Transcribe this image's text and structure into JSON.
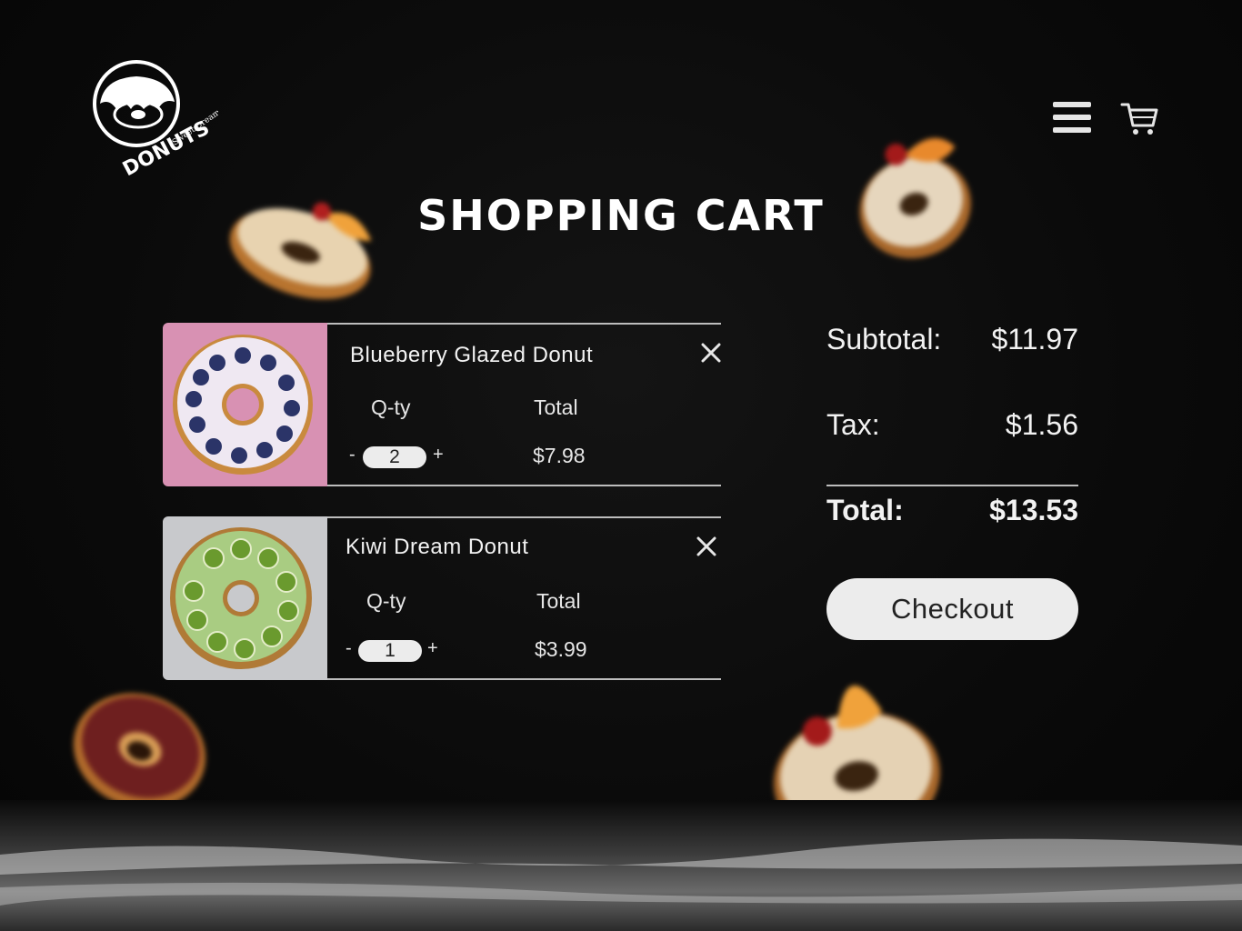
{
  "brand": {
    "logo_top": "Sweet Dream",
    "logo_main": "DONUTS"
  },
  "header": {
    "menu_icon": "hamburger-menu-icon",
    "cart_icon": "shopping-cart-icon"
  },
  "page_title": "SHOPPING CART",
  "cart": {
    "qty_label": "Q-ty",
    "total_label": "Total",
    "minus": "-",
    "plus": "+",
    "items": [
      {
        "name": "Blueberry Glazed Donut",
        "quantity": "2",
        "total": "$7.98"
      },
      {
        "name": "Kiwi Dream Donut",
        "quantity": "1",
        "total": "$3.99"
      }
    ]
  },
  "summary": {
    "subtotal_label": "Subtotal:",
    "subtotal_value": "$11.97",
    "tax_label": "Tax:",
    "tax_value": "$1.56",
    "total_label": "Total:",
    "total_value": "$13.53",
    "checkout_label": "Checkout"
  },
  "colors": {
    "background": "#0a0a0a",
    "text": "#ffffff",
    "button": "#ececec",
    "button_text": "#222222"
  }
}
